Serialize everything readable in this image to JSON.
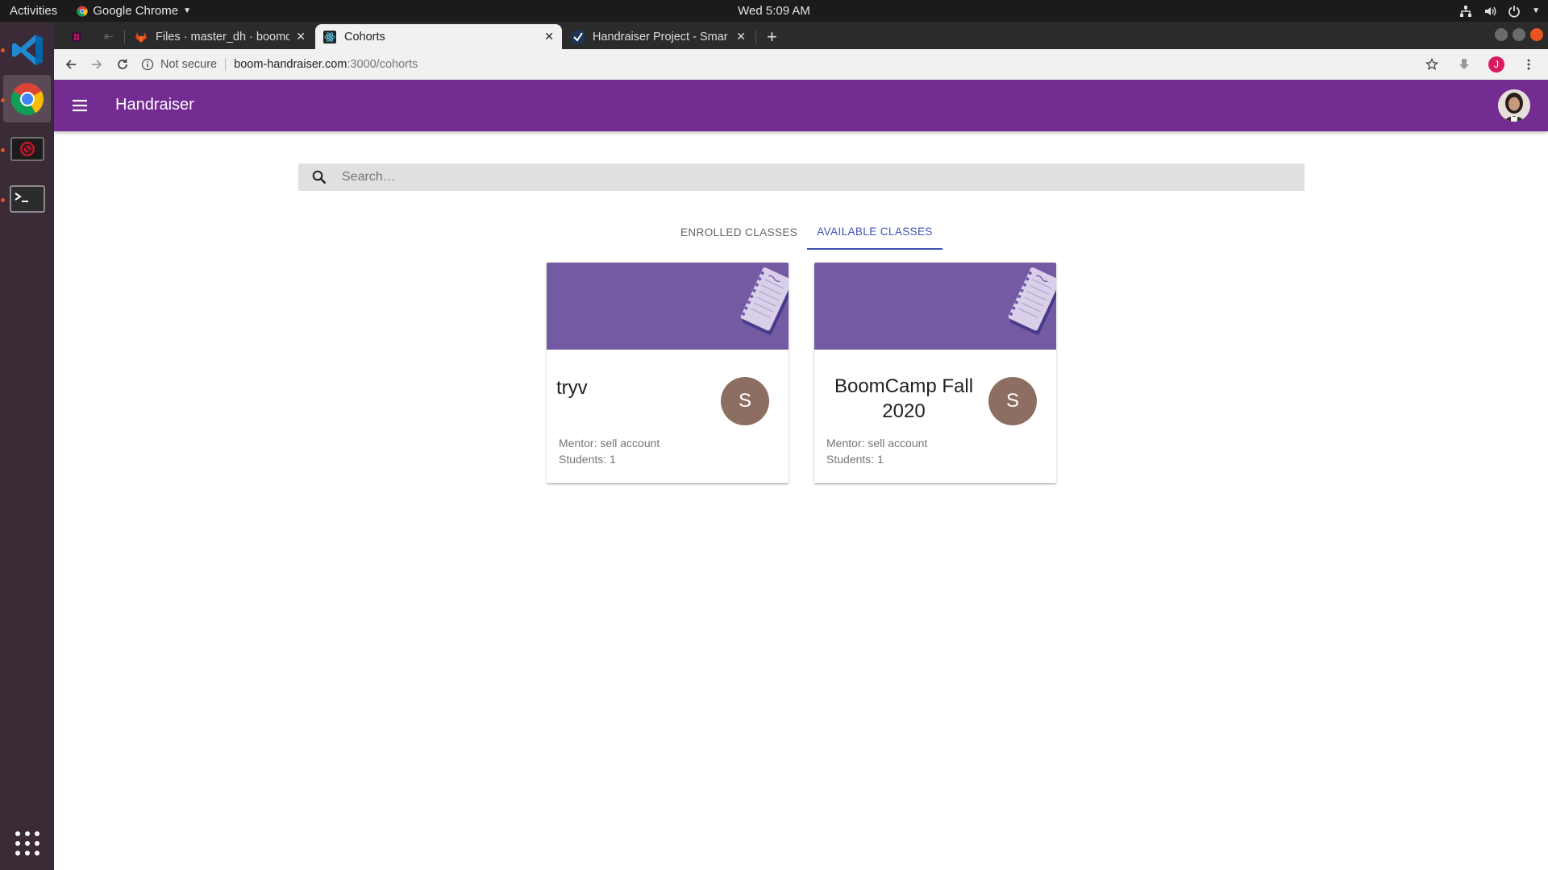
{
  "system": {
    "activities": "Activities",
    "app_menu": "Google Chrome",
    "clock": "Wed  5:09 AM"
  },
  "dock": {
    "apps": [
      "vscode-icon",
      "chrome-icon",
      "blocked-app-icon",
      "terminal-icon",
      "app-grid-icon"
    ]
  },
  "browser": {
    "tabs": [
      {
        "title": "",
        "icon": "slack-icon"
      },
      {
        "title": "Files · master_dh · boomc",
        "icon": "gitlab-icon"
      },
      {
        "title": "Cohorts",
        "icon": "react-icon",
        "active": true
      },
      {
        "title": "Handraiser Project - Smar",
        "icon": "check-icon"
      }
    ],
    "security_label": "Not secure",
    "url_host": "boom-handraiser.com",
    "url_path": ":3000/cohorts",
    "profile_initial": "J"
  },
  "app": {
    "title": "Handraiser",
    "brand_color": "#742b92",
    "search_placeholder": "Search…",
    "tabs": [
      {
        "label": "ENROLLED CLASSES"
      },
      {
        "label": "AVAILABLE CLASSES",
        "selected": true
      }
    ],
    "cards": [
      {
        "title": "tryv",
        "avatar": "S",
        "mentor": "Mentor: sell account",
        "students": "Students: 1"
      },
      {
        "title": "BoomCamp Fall 2020",
        "avatar": "S",
        "mentor": "Mentor: sell account",
        "students": "Students: 1"
      }
    ]
  }
}
